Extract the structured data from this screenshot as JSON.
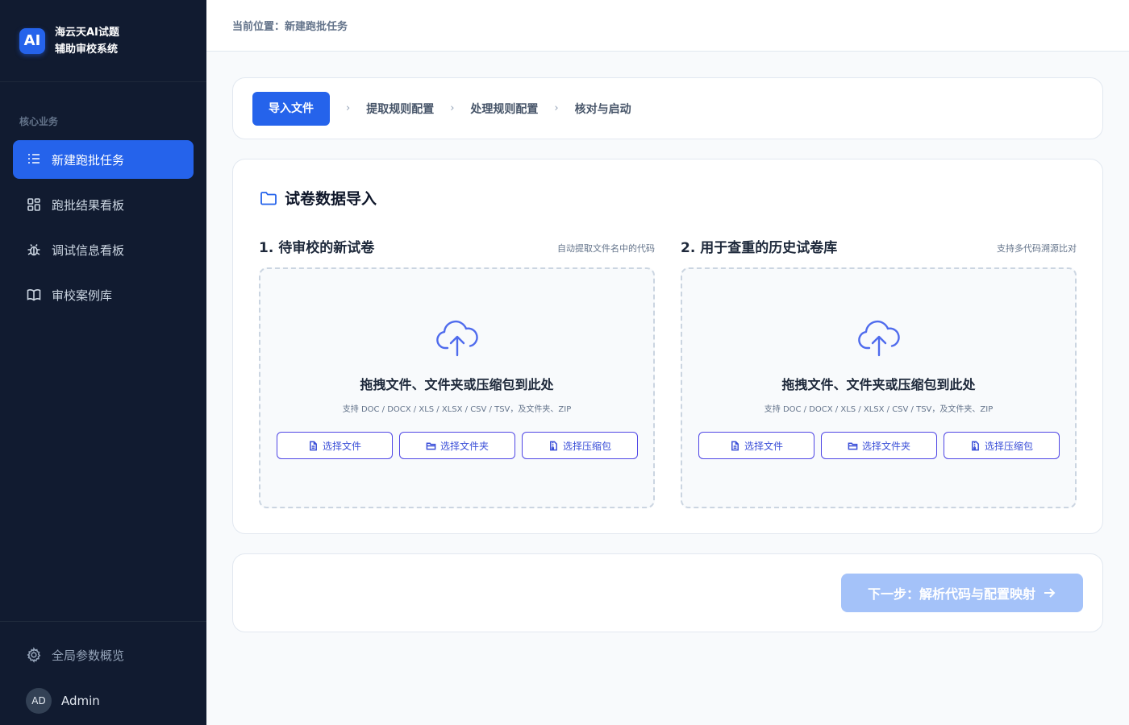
{
  "brand": {
    "logo": "AI",
    "line1": "海云天AI试题",
    "line2": "辅助审校系统"
  },
  "sidebar": {
    "section_label": "核心业务",
    "items": [
      {
        "label": "新建跑批任务",
        "icon": "list-icon",
        "active": true
      },
      {
        "label": "跑批结果看板",
        "icon": "dashboard-icon",
        "active": false
      },
      {
        "label": "调试信息看板",
        "icon": "bug-icon",
        "active": false
      },
      {
        "label": "审校案例库",
        "icon": "book-icon",
        "active": false
      }
    ],
    "settings_label": "全局参数概览",
    "user": {
      "initials": "AD",
      "name": "Admin"
    }
  },
  "header": {
    "breadcrumb": "当前位置：新建跑批任务"
  },
  "steps": {
    "items": [
      "导入文件",
      "提取规则配置",
      "处理规则配置",
      "核对与启动"
    ],
    "separator": "›",
    "active_index": 0
  },
  "import": {
    "title": "试卷数据导入",
    "left": {
      "title": "1. 待审校的新试卷",
      "hint": "自动提取文件名中的代码",
      "drop_text": "拖拽文件、文件夹或压缩包到此处",
      "formats": "支持 DOC / DOCX / XLS / XLSX / CSV / TSV，及文件夹、ZIP",
      "btn_file": "选择文件",
      "btn_folder": "选择文件夹",
      "btn_zip": "选择压缩包"
    },
    "right": {
      "title": "2. 用于查重的历史试卷库",
      "hint": "支持多代码溯源比对",
      "drop_text": "拖拽文件、文件夹或压缩包到此处",
      "formats": "支持 DOC / DOCX / XLS / XLSX / CSV / TSV，及文件夹、ZIP",
      "btn_file": "选择文件",
      "btn_folder": "选择文件夹",
      "btn_zip": "选择压缩包"
    }
  },
  "footer": {
    "next_label": "下一步：解析代码与配置映射"
  },
  "colors": {
    "sidebar_bg": "#111b30",
    "accent": "#2563eb",
    "next_disabled": "#a4c2f9"
  }
}
